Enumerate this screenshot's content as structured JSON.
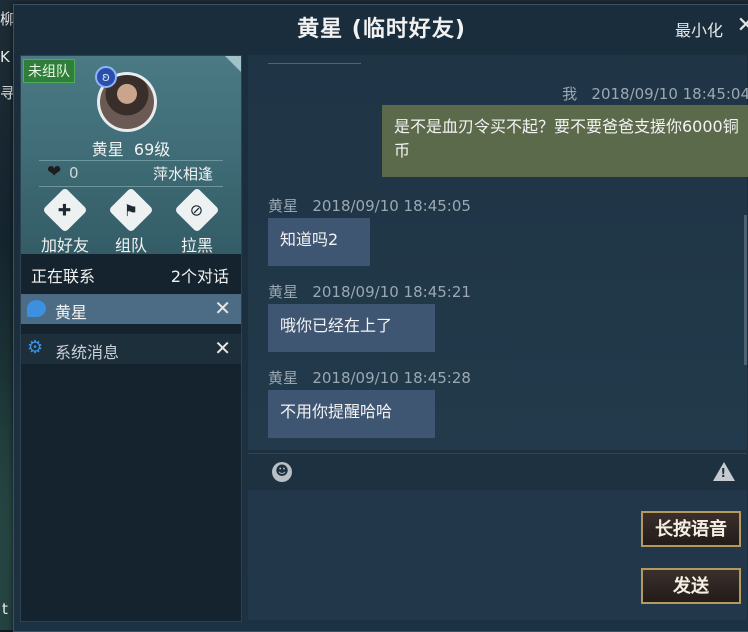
{
  "window": {
    "title": "黄星 (临时好友)",
    "minimize_label": "最小化",
    "close_label": "✕"
  },
  "background": {
    "fragment_1": "柳",
    "fragment_2": "K",
    "fragment_3": "寻",
    "fragment_4": "t"
  },
  "profile": {
    "team_status": "未组队",
    "name": "黄星",
    "level": "69级",
    "intimacy": "0",
    "relation": "萍水相逢",
    "actions": [
      {
        "label": "加好友",
        "icon": "add-friend-icon"
      },
      {
        "label": "组队",
        "icon": "team-flag-icon"
      },
      {
        "label": "拉黑",
        "icon": "block-icon"
      }
    ]
  },
  "contacts": {
    "header_label": "正在联系",
    "count_label": "2个对话",
    "items": [
      {
        "name": "黄星",
        "icon": "chat-bubble-icon",
        "active": true
      },
      {
        "name": "系统消息",
        "icon": "gear-icon",
        "active": false
      }
    ]
  },
  "messages": [
    {
      "sender": "我",
      "time": "2018/09/10  18:45:04",
      "text": "是不是血刃令买不起？要不要爸爸支援你6000铜币",
      "mine": true
    },
    {
      "sender": "黄星",
      "time": "2018/09/10  18:45:05",
      "text": "知道吗2",
      "mine": false
    },
    {
      "sender": "黄星",
      "time": "2018/09/10  18:45:21",
      "text": "哦你已经在上了",
      "mine": false
    },
    {
      "sender": "黄星",
      "time": "2018/09/10  18:45:28",
      "text": "不用你提醒哈哈",
      "mine": false
    }
  ],
  "input": {
    "voice_button": "长按语音",
    "send_button": "发送"
  },
  "colors": {
    "mine_bubble": "#5c6a4c",
    "their_bubble": "#3f5673",
    "accent_blue": "#3d8fe0",
    "button_border": "#b59a5d"
  }
}
